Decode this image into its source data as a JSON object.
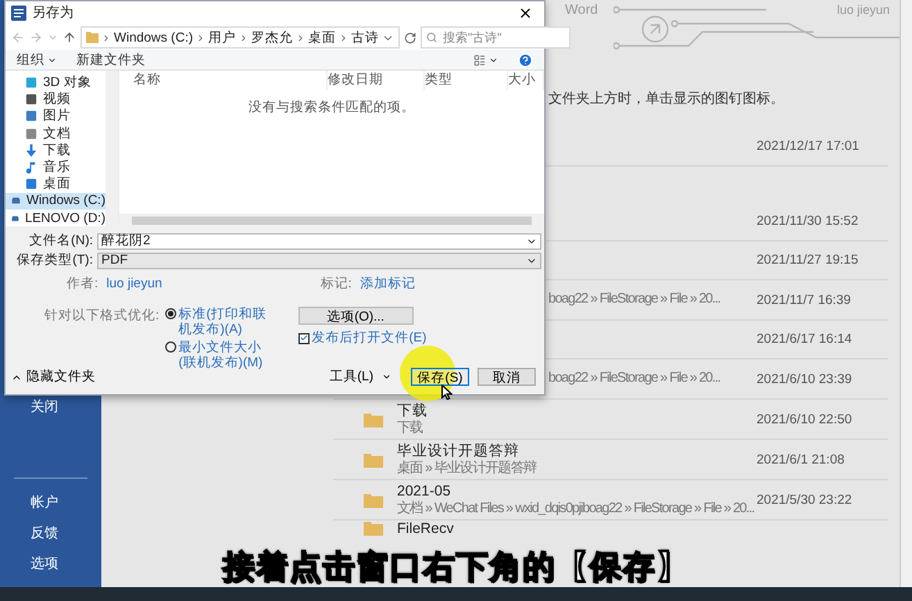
{
  "backstage": {
    "title": "Word",
    "user_name": "luo jieyun",
    "hint": "文件夹上方时，单击显示的图钉图标。"
  },
  "sidebar": {
    "top_items": [
      {
        "label": "关闭"
      }
    ],
    "bottom_items": [
      {
        "label": "帐户"
      },
      {
        "label": "反馈"
      },
      {
        "label": "选项"
      }
    ]
  },
  "recent_files": [
    {
      "kind": "covered",
      "date": "2021/12/17 17:01"
    },
    {
      "kind": "covered",
      "date": "2021/11/30 15:52"
    },
    {
      "kind": "covered",
      "date": "2021/11/27 19:15"
    },
    {
      "kind": "covered",
      "path": "boag22 » FileStorage » File » 20...",
      "date": "2021/11/7 16:39"
    },
    {
      "kind": "covered",
      "date": "2021/6/17 16:14"
    },
    {
      "kind": "covered",
      "path": "boag22 » FileStorage » File » 20...",
      "date": "2021/6/10 23:39"
    },
    {
      "kind": "folder",
      "name": "下载",
      "path": "下载",
      "date": "2021/6/10 22:50"
    },
    {
      "kind": "folder",
      "name": "毕业设计开题答辩",
      "path": "桌面 » 毕业设计开题答辩",
      "date": "2021/6/1 21:08"
    },
    {
      "kind": "folder",
      "name": "2021-05",
      "path": "文档 » WeChat Files » wxid_dqis0pjiboag22 » FileStorage » File » 20...",
      "date": "2021/5/30 23:22"
    },
    {
      "kind": "folder",
      "name": "FileRecv"
    }
  ],
  "dialog": {
    "title": "另存为",
    "breadcrumb": [
      "Windows (C:)",
      "用户",
      "罗杰允",
      "桌面",
      "古诗"
    ],
    "search": {
      "placeholder": "搜索\"古诗\""
    },
    "toolbar": {
      "organize": "组织",
      "new_folder": "新建文件夹"
    },
    "nav_items": [
      {
        "kind": "object3d",
        "label": "3D 对象",
        "selected": false
      },
      {
        "kind": "video",
        "label": "视频",
        "selected": false
      },
      {
        "kind": "pictures",
        "label": "图片",
        "selected": false
      },
      {
        "kind": "documents",
        "label": "文档",
        "selected": false
      },
      {
        "kind": "downloads",
        "label": "下载",
        "selected": false
      },
      {
        "kind": "music",
        "label": "音乐",
        "selected": false
      },
      {
        "kind": "desktop",
        "label": "桌面",
        "selected": false
      },
      {
        "kind": "drive",
        "label": "Windows (C:)",
        "selected": true
      },
      {
        "kind": "drive",
        "label": "LENOVO (D:)",
        "selected": false
      }
    ],
    "columns": [
      "名称",
      "修改日期",
      "类型",
      "大小"
    ],
    "empty_message": "没有与搜索条件匹配的项。",
    "file_name": {
      "label": "文件名(N):",
      "value": "醉花阴2"
    },
    "file_type": {
      "label": "保存类型(T):",
      "value": "PDF"
    },
    "author": {
      "label": "作者:",
      "value": "luo jieyun"
    },
    "tags": {
      "label": "标记:",
      "value": "添加标记"
    },
    "optimize": {
      "label": "针对以下格式优化:",
      "options": [
        {
          "label": "标准(打印和联机发布)(A)",
          "selected": true
        },
        {
          "label": "最小文件大小(联机发布)(M)",
          "selected": false
        }
      ]
    },
    "options_button": "选项(O)...",
    "open_after": {
      "label": "发布后打开文件(E)",
      "checked": true
    },
    "hide_folders": "隐藏文件夹",
    "tools": "工具(L)",
    "save": "保存(S)",
    "cancel": "取消"
  },
  "caption": "接着点击窗口右下角的【保存】"
}
